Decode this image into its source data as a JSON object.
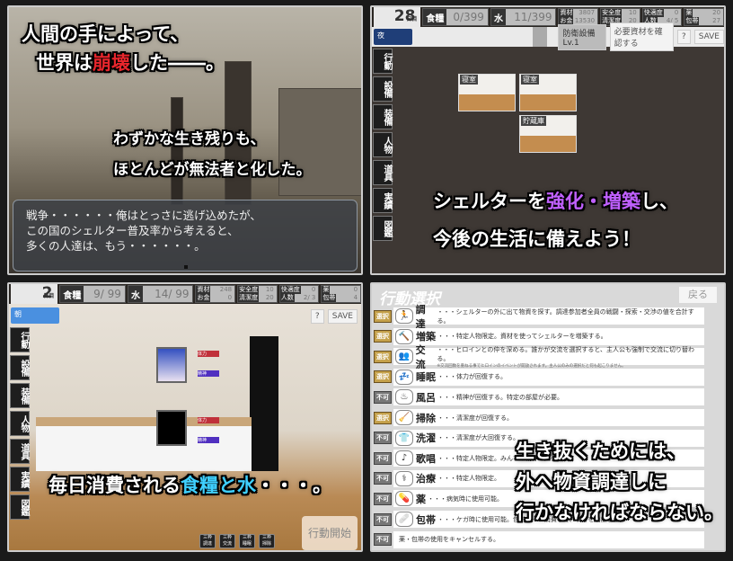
{
  "panel1": {
    "caption1": "人間の手によって、",
    "caption2_pre": "世界は",
    "caption2_em": "崩壊",
    "caption2_post": "した――。",
    "caption3": "わずかな生き残りも、",
    "caption4": "ほとんどが無法者と化した。",
    "dialog": [
      "戦争・・・・・・俺はとっさに逃げ込めたが、",
      "この国のシェルター普及率から考えると、",
      "多くの人達は、もう・・・・・・。"
    ]
  },
  "panel2": {
    "day": "28",
    "day_unit": "日目",
    "food_label": "食糧",
    "food": "0/399",
    "water_label": "水",
    "water": "11/399",
    "materials_label": "資材",
    "money_label": "お金",
    "materials": "3807",
    "money": "13530",
    "safety_label": "安全度",
    "clean_label": "清潔度",
    "safety": "10",
    "clean": "20",
    "comfort_label": "快適度",
    "people_label": "人数",
    "comfort": "0",
    "people": "4/ 5",
    "med_label": "薬",
    "bandage_label": "包帯",
    "med": "20",
    "bandage": "27",
    "time": "夜",
    "facility": "防衛設備 Lv.1",
    "facility_level_color": "#c8d23a",
    "confirm": "必要資材を確認する",
    "help": "?",
    "save": "SAVE",
    "menu": [
      "行動",
      "設備",
      "装備",
      "人物",
      "道具",
      "実績",
      "図鑑"
    ],
    "rooms": [
      "寝室",
      "寝室",
      "貯蔵庫"
    ],
    "caption1_pre": "シェルターを",
    "caption1_em": "強化・増築",
    "caption1_post": "し、",
    "caption2": "今後の生活に備えよう！"
  },
  "panel3": {
    "day": "2",
    "day_unit": "日目",
    "food_label": "食糧",
    "food": "9/ 99",
    "water_label": "水",
    "water": "14/ 99",
    "materials_label": "資材",
    "money_label": "お金",
    "materials": "248",
    "money": "0",
    "safety_label": "安全度",
    "clean_label": "清潔度",
    "safety": "10",
    "clean": "20",
    "comfort_label": "快適度",
    "people_label": "人数",
    "comfort": "0",
    "people": "2/ 3",
    "med_label": "薬",
    "bandage_label": "包帯",
    "med": "0",
    "bandage": "4",
    "time": "朝",
    "help": "?",
    "save": "SAVE",
    "menu": [
      "行動",
      "設備",
      "装備",
      "人物",
      "道具",
      "実績",
      "図鑑"
    ],
    "gauge_hp": "体力",
    "gauge_mind": "精神",
    "schedule": [
      "調達",
      "交流",
      "睡眠",
      "掃除"
    ],
    "schedule_prefix": "三枠",
    "start": "行動開始",
    "caption_pre": "毎日消費される",
    "caption_em": "食糧と水",
    "caption_post": "・・・。"
  },
  "panel4": {
    "title": "行動選択",
    "back": "戻る",
    "select_label": "選択",
    "disabled_label": "不可",
    "rows": [
      {
        "name": "調達",
        "desc": "・・・シェルターの外に出て物資を探す。調達参加者全員の戦闘・探索・交渉の値を合計する。",
        "enabled": true,
        "icon": "🏃"
      },
      {
        "name": "増築",
        "desc": "・・・特定人物限定。資材を使ってシェルターを増築する。",
        "enabled": true,
        "icon": "🔨"
      },
      {
        "name": "交流",
        "desc": "・・・ヒロインとの仲を深める。誰かが交流を選択すると、主人公も強制で交流に切り替わる。",
        "note": "※交流回数を重ねる事でヒロインのイベントが開放されます。主人公のみの選択だと何も起こりません。",
        "enabled": true,
        "icon": "👥"
      },
      {
        "name": "睡眠",
        "desc": "・・・体力が回復する。",
        "enabled": true,
        "icon": "💤"
      },
      {
        "name": "風呂",
        "desc": "・・・精神が回復する。特定の部屋が必要。",
        "enabled": false,
        "icon": "♨"
      },
      {
        "name": "掃除",
        "desc": "・・・清潔度が回復する。",
        "enabled": true,
        "icon": "🧹"
      },
      {
        "name": "洗濯",
        "desc": "・・・清潔度が大回復する。",
        "enabled": false,
        "icon": "👕"
      },
      {
        "name": "歌唱",
        "desc": "・・・特定人物限定。みんなの精神が回復する。",
        "enabled": false,
        "icon": "♪"
      },
      {
        "name": "治療",
        "desc": "・・・特定人物限定。",
        "enabled": false,
        "icon": "⚕"
      },
      {
        "name": "薬",
        "desc": "・・・病気時に使用可能。",
        "enabled": false,
        "icon": "💊"
      },
      {
        "name": "包帯",
        "desc": "・・・ケガ時に使用可能。包帯を一つ消費して、ケガを治療する。",
        "enabled": false,
        "icon": "🩹"
      },
      {
        "name": "",
        "desc": "薬・包帯の使用をキャンセルする。",
        "enabled": false,
        "icon": ""
      }
    ],
    "caption": [
      "生き抜くためには、",
      "外へ物資調達しに",
      "行かなければならない。"
    ]
  }
}
